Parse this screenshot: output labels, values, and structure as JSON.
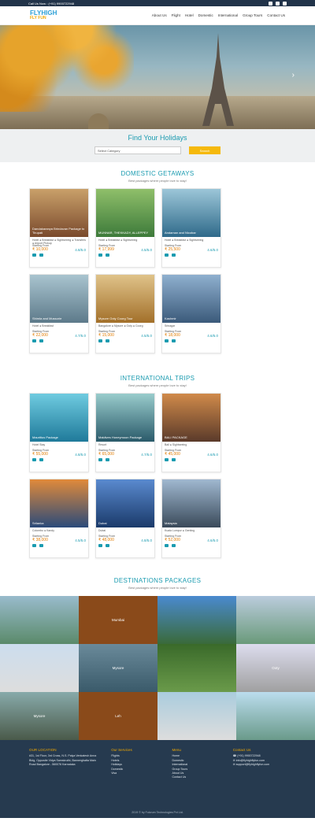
{
  "topbar": {
    "call": "Call Us Now : (+91) 9900722948"
  },
  "nav": {
    "logo_main": "FLYHIGH",
    "logo_sub": "FLY FUN",
    "items": [
      "About Us",
      "Flight",
      "Hotel",
      "Domestic",
      "International",
      "Group Tours",
      "Contact Us"
    ]
  },
  "search": {
    "title": "Find Your Holidays",
    "select": "Select Category",
    "button": "Search"
  },
  "domestic": {
    "title": "DOMESTIC GETAWAYS",
    "subtitle": "Best packages where people love to stay!",
    "cards": [
      {
        "title": "Dandakaranya Brindavan Package to Tirupati",
        "inc": "Hotel ● Breakfast ● Sightseeing ● Transfers ● Airport Pickup",
        "price": "₹ 10,000",
        "rating": "4.8/5.0"
      },
      {
        "title": "MUNNAR, THEKKADY, ALLEPPEY",
        "inc": "Hotel ● Breakfast ● Sightseeing",
        "price": "₹ 17,999",
        "rating": "4.5/5.0"
      },
      {
        "title": "Andaman and Nicobar",
        "inc": "Hotel ● Breakfast ● Sightseeing",
        "price": "₹ 25,500",
        "rating": "4.6/5.0"
      },
      {
        "title": "Shimla and Mussorie",
        "inc": "Hotel ● Breakfast",
        "price": "₹ 22,000",
        "rating": "4.7/5.0"
      },
      {
        "title": "Mysore Ooty Coorg Tour",
        "inc": "Bangalore ● Mysore ● Ooty ● Coorg",
        "price": "₹ 15,000",
        "rating": "4.5/5.0"
      },
      {
        "title": "Kashmir",
        "inc": "Srinagar",
        "price": "₹ 18,000",
        "rating": "4.6/5.0"
      }
    ]
  },
  "international": {
    "title": "INTERNATIONAL TRIPS",
    "subtitle": "Best packages where people love to stay!",
    "cards": [
      {
        "title": "Mauritius Package",
        "inc": "Hotel Stay",
        "price": "₹ 55,000",
        "rating": "4.8/5.0"
      },
      {
        "title": "Maldives Honeymoon Package",
        "inc": "Resort",
        "price": "₹ 65,000",
        "rating": "4.7/5.0"
      },
      {
        "title": "BALI PACKAGE",
        "inc": "Bali ● Sightseeing",
        "price": "₹ 45,000",
        "rating": "4.6/5.0"
      },
      {
        "title": "Srilanka",
        "inc": "Colombo ● Kandy",
        "price": "₹ 38,000",
        "rating": "4.5/5.0"
      },
      {
        "title": "Dubai",
        "inc": "Dubai",
        "price": "₹ 48,000",
        "rating": "4.8/5.0"
      },
      {
        "title": "Malaysia",
        "inc": "Kuala Lumpur ● Genting",
        "price": "₹ 52,000",
        "rating": "4.6/5.0"
      }
    ]
  },
  "destinations": {
    "title": "DESTINATIONS PACKAGES",
    "subtitle": "Best packages where people love to stay!",
    "tiles": [
      "",
      "Mumbai",
      "",
      "",
      "",
      "Mysore",
      "",
      "Ooty",
      "Mysore",
      "Leh",
      "",
      ""
    ]
  },
  "footer": {
    "office": {
      "title": "OUR LOCATION",
      "text": "#31, 1st Floor, 3rd Cross, N.S. Palya Venkatesh Anna Bldg, Opposite Vidya Samskruthi, Bannerghatta Main Road Bangalore - 560076 Karnataka"
    },
    "services": {
      "title": "Our Services",
      "items": [
        "Flights",
        "Hotels",
        "Holidays",
        "Domestic",
        "Visa"
      ]
    },
    "links": {
      "title": "Menu",
      "items": [
        "Home",
        "Domestic",
        "International",
        "Group Tours",
        "About Us",
        "Contact Us"
      ]
    },
    "contact": {
      "title": "Contact Us",
      "phone": "(+91) 9900722948",
      "email1": "info@flyhighflyfun.com",
      "email2": "support@flyhighflyfun.com"
    },
    "copy": "2019 © by Fulcrum Technologies Pvt Ltd."
  }
}
